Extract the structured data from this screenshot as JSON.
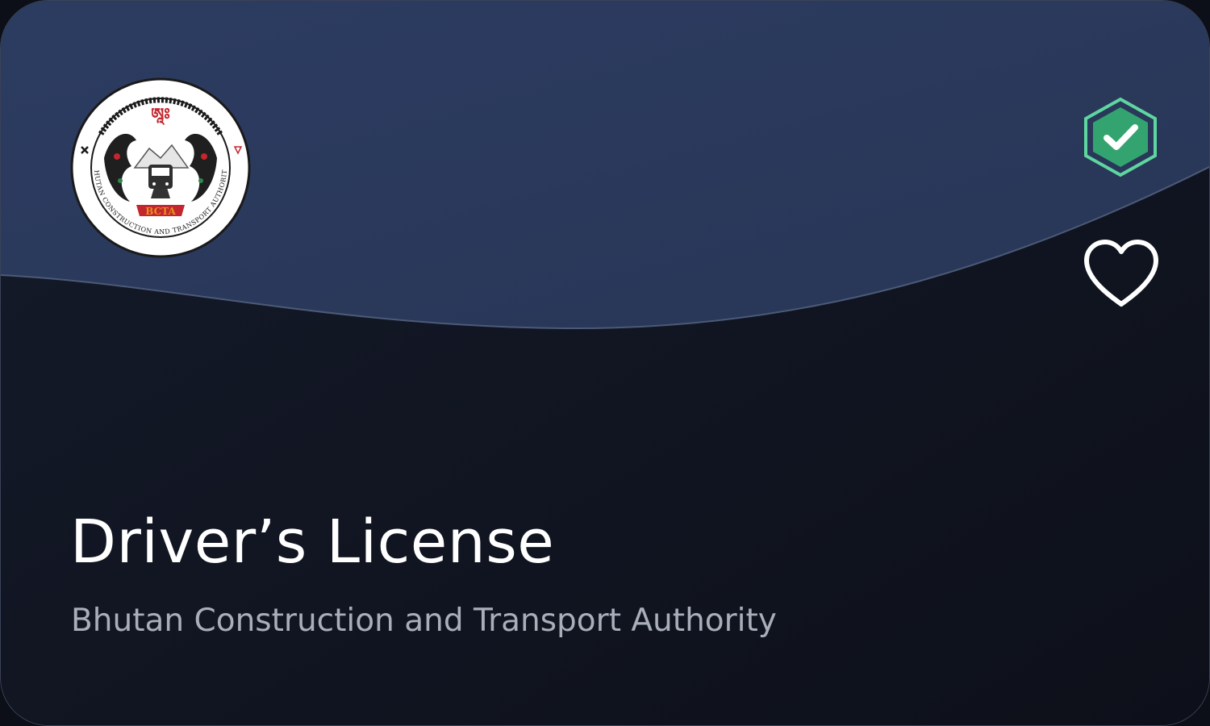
{
  "card": {
    "title": "Driver’s License",
    "issuer": "Bhutan Construction and Transport Authority"
  },
  "seal": {
    "name": "BCTA",
    "ring_text": "BHUTAN CONSTRUCTION AND TRANSPORT AUTHORITY"
  },
  "icons": {
    "verified": "verified-check-icon",
    "favorite": "heart-icon"
  },
  "colors": {
    "header": "#2a3a5f",
    "body": "#121725",
    "verified_green": "#33a46f",
    "verified_border": "#5fd6a0",
    "seal_red": "#c3262d",
    "seal_orange": "#e8911f"
  }
}
